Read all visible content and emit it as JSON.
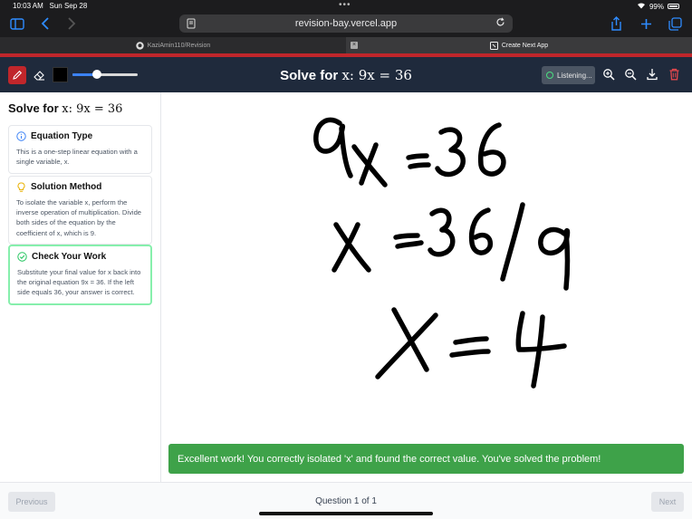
{
  "status": {
    "time": "10:03 AM",
    "date": "Sun Sep 28",
    "battery": "99%"
  },
  "browser": {
    "url": "revision-bay.vercel.app",
    "tabs": [
      {
        "label": "KaziAmin110/Revision",
        "active": false
      },
      {
        "label": "Create Next App",
        "active": true
      }
    ]
  },
  "toolbar": {
    "title_prefix": "Solve for ",
    "title_math": "x: 9x = 36",
    "listening_label": "Listening...",
    "pen_color": "#000000",
    "brush_size": 0.38
  },
  "sidebar": {
    "title_prefix": "Solve for ",
    "title_math": "x: 9x = 36",
    "cards": [
      {
        "heading": "Equation Type",
        "body": "This is a one-step linear equation with a single variable, x.",
        "icon": "info-icon"
      },
      {
        "heading": "Solution Method",
        "body": "To isolate the variable x, perform the inverse operation of multiplication. Divide both sides of the equation by the coefficient of x, which is 9.",
        "icon": "lightbulb-icon"
      },
      {
        "heading": "Check Your Work",
        "body": "Substitute your final value for x back into the original equation 9x = 36. If the left side equals 36, your answer is correct.",
        "icon": "check-circle-icon"
      }
    ]
  },
  "canvas": {
    "handwritten_lines": [
      "9x = 36",
      "x = 36/9",
      "X = 4"
    ]
  },
  "feedback": {
    "message": "Excellent work! You correctly isolated 'x' and found the correct value. You've solved the problem!",
    "color": "#3ea249"
  },
  "footer": {
    "previous_label": "Previous",
    "next_label": "Next",
    "counter": "Question 1 of 1"
  }
}
